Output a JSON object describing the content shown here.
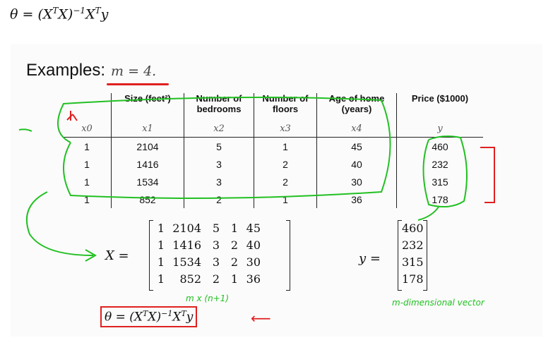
{
  "top_formula": {
    "lhs": "θ = (X",
    "t1": "T",
    "mid": "X)",
    "inv": "−1",
    "x": "X",
    "t2": "T",
    "y": "y"
  },
  "slide": {
    "examples_label": "Examples:",
    "m_expr": "m = 4.",
    "columns": [
      {
        "header": "",
        "symbol": "x0"
      },
      {
        "header": "Size (feet²)",
        "symbol": "x1"
      },
      {
        "header": "Number of bedrooms",
        "symbol": "x2"
      },
      {
        "header": "Number of floors",
        "symbol": "x3"
      },
      {
        "header": "Age of home (years)",
        "symbol": "x4"
      },
      {
        "header": "Price ($1000)",
        "symbol": "y"
      }
    ],
    "rows": [
      [
        "1",
        "2104",
        "5",
        "1",
        "45",
        "460"
      ],
      [
        "1",
        "1416",
        "3",
        "2",
        "40",
        "232"
      ],
      [
        "1",
        "1534",
        "3",
        "2",
        "30",
        "315"
      ],
      [
        "1",
        "852",
        "2",
        "1",
        "36",
        "178"
      ]
    ],
    "x_label": "X =",
    "X_matrix": [
      [
        "1",
        "2104",
        "5",
        "1",
        "45"
      ],
      [
        "1",
        "1416",
        "3",
        "2",
        "40"
      ],
      [
        "1",
        "1534",
        "3",
        "2",
        "30"
      ],
      [
        "1",
        "852",
        "2",
        "1",
        "36"
      ]
    ],
    "y_label": "y =",
    "y_vector": [
      "460",
      "232",
      "315",
      "178"
    ],
    "note_dim": "m x (n+1)",
    "note_vector": "m-dimensional vector",
    "theta_formula": {
      "lhs": "θ = (X",
      "t1": "T",
      "mid": "X)",
      "inv": "−1",
      "x": "X",
      "t2": "T",
      "y": "y"
    }
  },
  "colors": {
    "annotation_green": "#22c022",
    "annotation_red": "#e02020"
  }
}
